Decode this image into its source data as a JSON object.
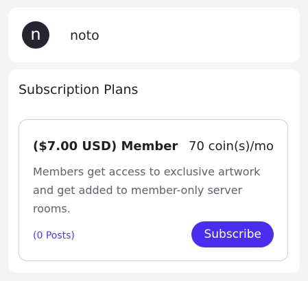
{
  "profile": {
    "avatar_letter": "n",
    "username": "noto"
  },
  "subscriptions": {
    "title": "Subscription Plans",
    "plans": [
      {
        "name": "($7.00 USD) Member",
        "price": "70 coin(s)/mo",
        "description": "Members get access to exclusive artwork and get added to member-only server rooms.",
        "posts_label": "(0 Posts)",
        "subscribe_label": "Subscribe"
      }
    ]
  },
  "colors": {
    "accent": "#4a2ef0",
    "link": "#4a3ddb",
    "avatar_bg": "#25252f"
  }
}
